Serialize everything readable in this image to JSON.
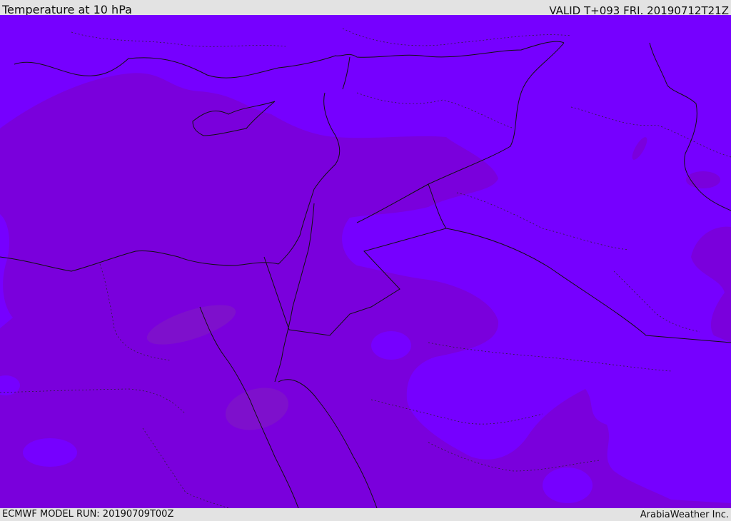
{
  "header": {
    "title": "Temperature at 10 hPa",
    "valid": "VALID T+093 FRI. 20190712T21Z"
  },
  "footer": {
    "model_run": "ECMWF MODEL RUN: 20190709T00Z",
    "credit": "ArabiaWeather Inc."
  },
  "map": {
    "field": "Temperature",
    "level": "10 hPa",
    "colors": {
      "warm_band": "#7a00dc",
      "cool_band": "#7600ff",
      "pocket": "#7e10cc",
      "coast": "#111111"
    }
  }
}
